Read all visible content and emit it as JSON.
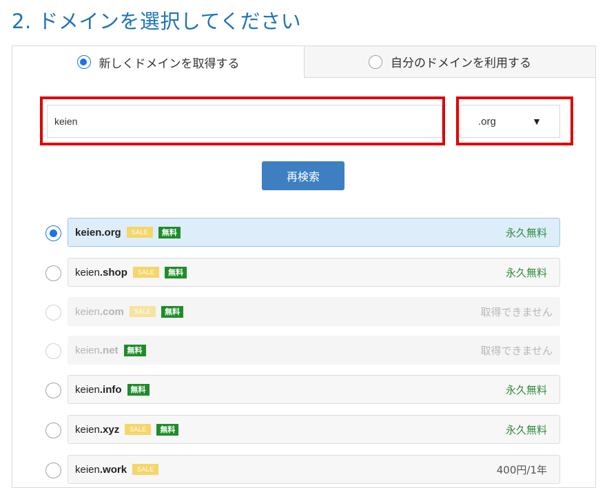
{
  "title": "2. ドメインを選択してください",
  "tabs": [
    {
      "label": "新しくドメインを取得する",
      "selected": true
    },
    {
      "label": "自分のドメインを利用する",
      "selected": false
    }
  ],
  "search": {
    "value": "keien",
    "tld": ".org",
    "caret": "▼"
  },
  "research_label": "再検索",
  "badges": {
    "sale": "SALE",
    "free": "無料"
  },
  "domains": [
    {
      "base": "keien",
      "tld": ".org",
      "sale": true,
      "free": true,
      "status": "永久無料",
      "selected": true,
      "available": true
    },
    {
      "base": "keien",
      "tld": ".shop",
      "sale": true,
      "free": true,
      "status": "永久無料",
      "selected": false,
      "available": true
    },
    {
      "base": "keien",
      "tld": ".com",
      "sale": true,
      "free": true,
      "status": "取得できません",
      "selected": false,
      "available": false
    },
    {
      "base": "keien",
      "tld": ".net",
      "sale": false,
      "free": true,
      "status": "取得できません",
      "selected": false,
      "available": false
    },
    {
      "base": "keien",
      "tld": ".info",
      "sale": false,
      "free": true,
      "status": "永久無料",
      "selected": false,
      "available": true
    },
    {
      "base": "keien",
      "tld": ".xyz",
      "sale": true,
      "free": true,
      "status": "永久無料",
      "selected": false,
      "available": true
    },
    {
      "base": "keien",
      "tld": ".work",
      "sale": true,
      "free": false,
      "status": "400円/1年",
      "selected": false,
      "available": true
    }
  ],
  "colors": {
    "accent": "#1f73b7",
    "highlight": "#e00000",
    "free": "#1f8c2a",
    "sale": "#f5d66a"
  }
}
